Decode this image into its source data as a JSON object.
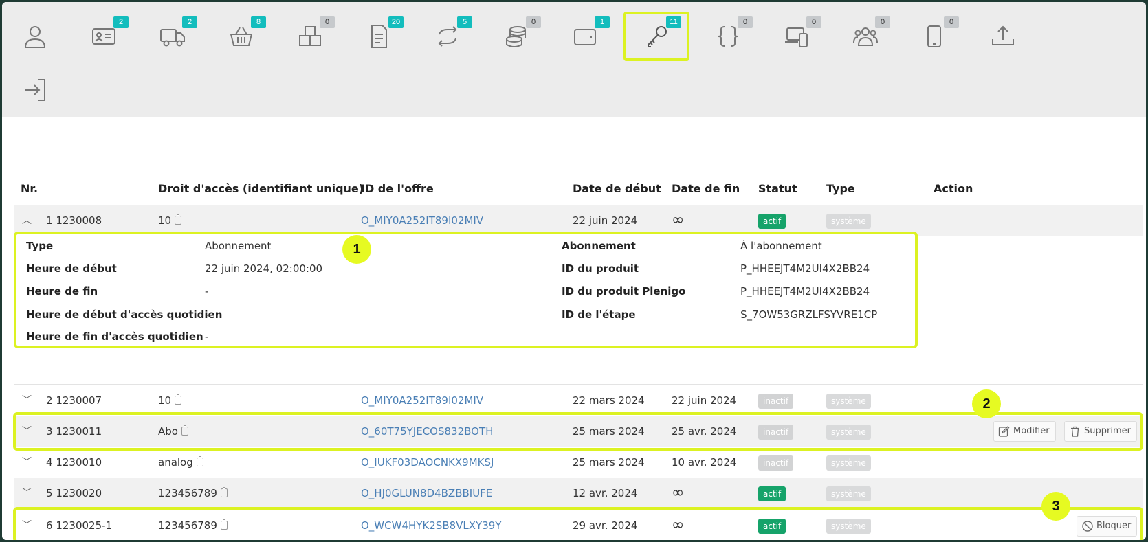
{
  "nav": {
    "tabs": [
      {
        "icon": "user-icon",
        "badge": null,
        "active": false
      },
      {
        "icon": "id-card-icon",
        "badge": "2",
        "active": false
      },
      {
        "icon": "truck-icon",
        "badge": "2",
        "active": false
      },
      {
        "icon": "basket-icon",
        "badge": "8",
        "active": false
      },
      {
        "icon": "boxes-icon",
        "badge": "0",
        "active": false
      },
      {
        "icon": "invoice-icon",
        "badge": "20",
        "active": false
      },
      {
        "icon": "sync-icon",
        "badge": "5",
        "active": false
      },
      {
        "icon": "coins-icon",
        "badge": "0",
        "active": false
      },
      {
        "icon": "wallet-icon",
        "badge": "1",
        "active": false
      },
      {
        "icon": "key-icon",
        "badge": "11",
        "active": true
      },
      {
        "icon": "braces-icon",
        "badge": "0",
        "active": false
      },
      {
        "icon": "devices-icon",
        "badge": "0",
        "active": false
      },
      {
        "icon": "users-icon",
        "badge": "0",
        "active": false
      },
      {
        "icon": "phone-icon",
        "badge": "0",
        "active": false
      },
      {
        "icon": "upload-icon",
        "badge": null,
        "active": false
      }
    ],
    "logout_icon": "sign-in-icon"
  },
  "table": {
    "headers": {
      "nr": "Nr.",
      "right": "Droit d'accès (identifiant unique)",
      "offer": "ID de l'offre",
      "start": "Date de début",
      "end": "Date de fin",
      "status": "Statut",
      "type": "Type",
      "action": "Action"
    },
    "rows": [
      {
        "num": "1",
        "id": "1230008",
        "right": "10",
        "offer": "O_MIY0A252IT89I02MIV",
        "start": "22 juin 2024",
        "end": "∞",
        "status": "actif",
        "type": "système",
        "expanded": true
      },
      {
        "num": "2",
        "id": "1230007",
        "right": "10",
        "offer": "O_MIY0A252IT89I02MIV",
        "start": "22 mars 2024",
        "end": "22 juin 2024",
        "status": "inactif",
        "type": "système"
      },
      {
        "num": "3",
        "id": "1230011",
        "right": "Abo",
        "offer": "O_60T75YJECOS832BOTH",
        "start": "25 mars 2024",
        "end": "25 avr. 2024",
        "status": "inactif",
        "type": "système"
      },
      {
        "num": "4",
        "id": "1230010",
        "right": "analog",
        "offer": "O_IUKF03DAOCNKX9MKSJ",
        "start": "25 mars 2024",
        "end": "10 avr. 2024",
        "status": "inactif",
        "type": "système"
      },
      {
        "num": "5",
        "id": "1230020",
        "right": "123456789",
        "offer": "O_HJ0GLUN8D4BZBBIUFE",
        "start": "12 avr. 2024",
        "end": "∞",
        "status": "actif",
        "type": "système"
      },
      {
        "num": "6",
        "id": "1230025-1",
        "right": "123456789",
        "offer": "O_WCW4HYK2SB8VLXY39Y",
        "start": "29 avr. 2024",
        "end": "∞",
        "status": "actif",
        "type": "système"
      }
    ]
  },
  "detail": {
    "left": [
      {
        "label": "Type",
        "value": "Abonnement"
      },
      {
        "label": "Heure de début",
        "value": "22 juin 2024, 02:00:00"
      },
      {
        "label": "Heure de fin",
        "value": "-"
      },
      {
        "label": "Heure de début d'accès quotidien",
        "value": "-"
      },
      {
        "label": "Heure de fin d'accès quotidien",
        "value": "-"
      }
    ],
    "right": [
      {
        "label": "Abonnement",
        "value": "À l'abonnement"
      },
      {
        "label": "ID du produit",
        "value": "P_HHEEJT4M2UI4X2BB24"
      },
      {
        "label": "ID du produit Plenigo",
        "value": "P_HHEEJT4M2UI4X2BB24"
      },
      {
        "label": "ID de l'étape",
        "value": "S_7OW53GRZLFSYVRE1CP"
      }
    ]
  },
  "actions": {
    "modify": "Modifier",
    "delete": "Supprimer",
    "block": "Bloquer"
  },
  "callouts": [
    "1",
    "2",
    "3"
  ],
  "colors": {
    "highlight": "#dcf222",
    "badge_active": "#13bdbd",
    "status_active": "#16a36a",
    "link": "#4a7fb5"
  }
}
